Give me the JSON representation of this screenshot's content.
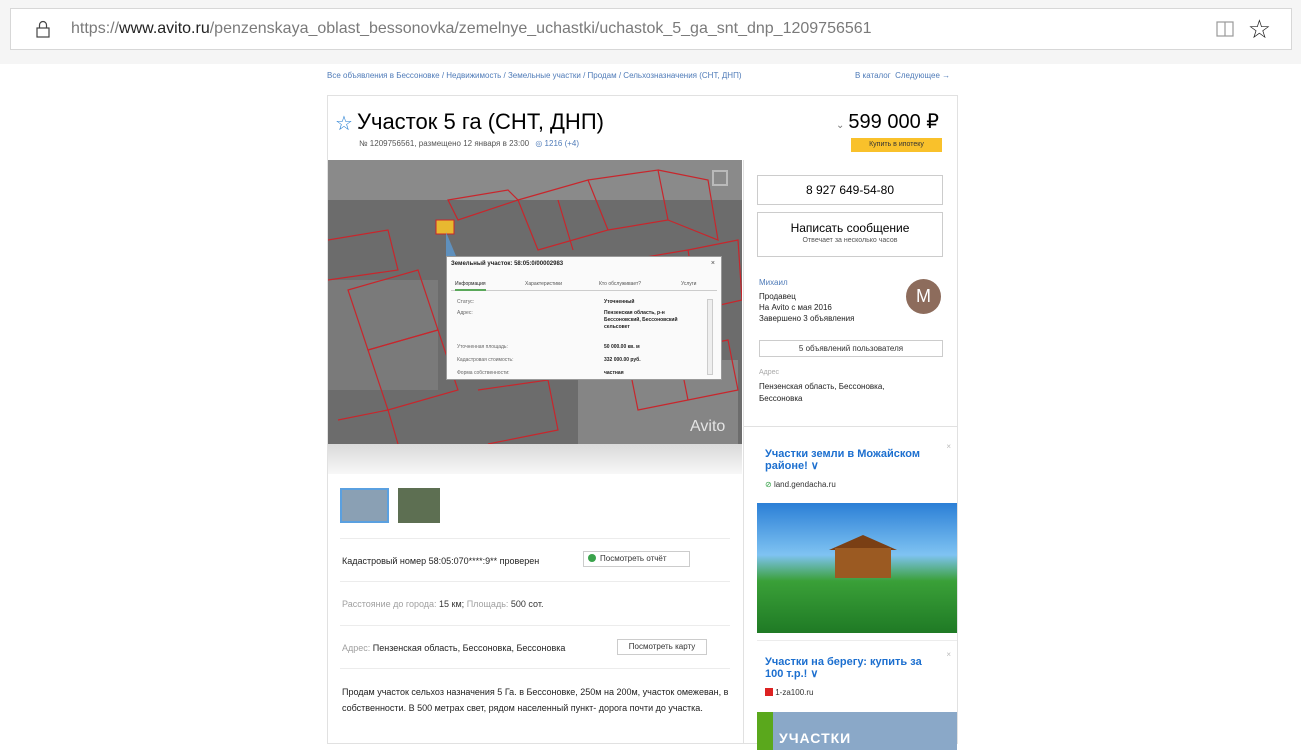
{
  "browser": {
    "url_prefix": "https://",
    "url_domain": "www.avito.ru",
    "url_path": "/penzenskaya_oblast_bessonovka/zemelnye_uchastki/uchastok_5_ga_snt_dnp_1209756561"
  },
  "breadcrumbs": {
    "path": "Все объявления в Бессоновке / Недвижимость / Земельные участки / Продам / Сельхозназначения (СНТ, ДНП)",
    "catalog_link": "В каталог",
    "next_link": "Следующее →"
  },
  "listing": {
    "title": "Участок 5 га (СНТ, ДНП)",
    "meta": "№ 1209756561, размещено 12 января в 23:00",
    "views": "1216 (+4)",
    "price": "599 000 ₽",
    "mortgage_button": "Купить в ипотеку"
  },
  "map_popup": {
    "title": "Земельный участок: 58:05:0/00002983",
    "close": "×",
    "tabs": [
      "Информация",
      "Характеристики",
      "Кто обслуживает?",
      "Услуги"
    ],
    "rows": [
      {
        "label": "Статус:",
        "value": "Уточненный"
      },
      {
        "label": "Адрес:",
        "value": "Пензенская область, р-н Бессоновский, Бессоновский сельсовет"
      },
      {
        "label": "Уточненная площадь:",
        "value": "50 000.00 кв. м"
      },
      {
        "label": "Кадастровая стоимость:",
        "value": "332 000.00 руб."
      },
      {
        "label": "Форма собственности:",
        "value": "частная"
      }
    ],
    "watermark": "Avito"
  },
  "details": {
    "cadastral": "Кадастровый номер 58:05:070****:9** проверен",
    "report_button": "Посмотреть отчёт",
    "distance_label": "Расстояние до города:",
    "distance_value": "15 км;",
    "area_label": "Площадь:",
    "area_value": "500 сот.",
    "address_label": "Адрес:",
    "address_value": "Пензенская область, Бессоновка, Бессоновка",
    "map_button": "Посмотреть карту",
    "description": "Продам участок сельхоз назначения 5 Га. в Бессоновке, 250м на 200м, участок омежеван, в собственности. В 500 метрах свет, рядом населенный пункт- дорога почти до участка."
  },
  "sidebar": {
    "phone": "8 927 649-54-80",
    "message_button": "Написать сообщение",
    "message_sub": "Отвечает за несколько часов",
    "seller_name": "Михаил",
    "seller_role": "Продавец",
    "seller_since": "На Avito с мая 2016",
    "seller_closed": "Завершено 3 объявления",
    "avatar_letter": "М",
    "user_ads_button": "5 объявлений пользователя",
    "address_label": "Адрес",
    "address_value": "Пензенская область, Бессоновка, Бессоновка"
  },
  "ads": [
    {
      "title": "Участки земли в Можайском районе! ∨",
      "domain": "land.gendacha.ru",
      "close": "×"
    },
    {
      "title": "Участки на берегу: купить за 100 т.р.! ∨",
      "domain": "1-za100.ru",
      "close": "×",
      "image_text": "УЧАСТКИ"
    }
  ],
  "colors": {
    "link": "#4f7bb8",
    "accent_blue": "#1c6fcf",
    "mortgage_yellow": "#f9c12b",
    "verified_green": "#3aa34c"
  }
}
